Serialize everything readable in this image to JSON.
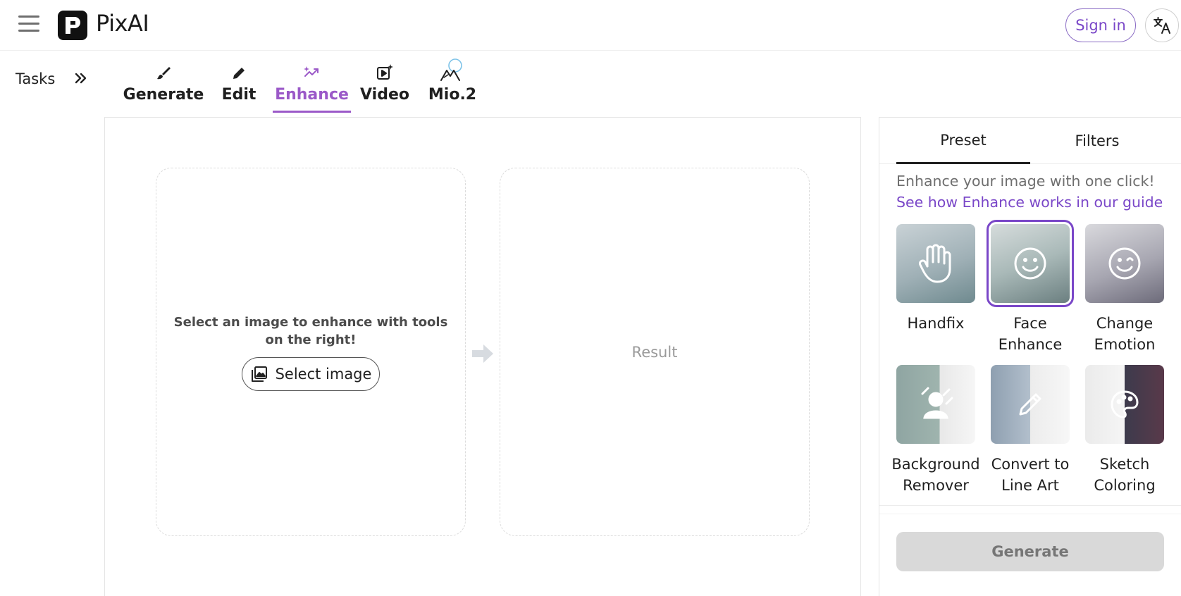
{
  "header": {
    "logo_text": "PixAI",
    "sign_in_label": "Sign in"
  },
  "sidebar": {
    "tasks_label": "Tasks"
  },
  "mode_tabs": [
    {
      "label": "Generate",
      "icon": "brush-icon",
      "active": false
    },
    {
      "label": "Edit",
      "icon": "pencil-icon",
      "active": false
    },
    {
      "label": "Enhance",
      "icon": "enhance-sparkle-icon",
      "active": true
    },
    {
      "label": "Video",
      "icon": "video-sparkle-icon",
      "active": false
    },
    {
      "label": "Mio.2",
      "icon": "mio-mountain-icon",
      "active": false
    }
  ],
  "workspace": {
    "prompt_text": "Select an image to enhance with tools on the right!",
    "select_button_label": "Select image",
    "result_label": "Result"
  },
  "panel": {
    "tabs": [
      {
        "label": "Preset",
        "active": true
      },
      {
        "label": "Filters",
        "active": false
      }
    ],
    "intro_text": "Enhance your image with one click!",
    "guide_link": "See how Enhance works in our guide",
    "presets": [
      {
        "label_lines": [
          "Handfix"
        ],
        "icon": "hand-icon",
        "selected": false
      },
      {
        "label_lines": [
          "Face",
          "Enhance"
        ],
        "icon": "smiley-icon",
        "selected": true
      },
      {
        "label_lines": [
          "Change",
          "Emotion"
        ],
        "icon": "wink-icon",
        "selected": false
      },
      {
        "label_lines": [
          "Background",
          "Remover"
        ],
        "icon": "person-cutout-icon",
        "selected": false
      },
      {
        "label_lines": [
          "Convert to",
          "Line Art"
        ],
        "icon": "pencil-icon",
        "selected": false
      },
      {
        "label_lines": [
          "Sketch",
          "Coloring"
        ],
        "icon": "palette-icon",
        "selected": false
      }
    ],
    "generate_label": "Generate"
  },
  "colors": {
    "accent": "#7a47c8",
    "active_tab": "#9b59c8",
    "disabled_button": "#d9d9d9"
  }
}
